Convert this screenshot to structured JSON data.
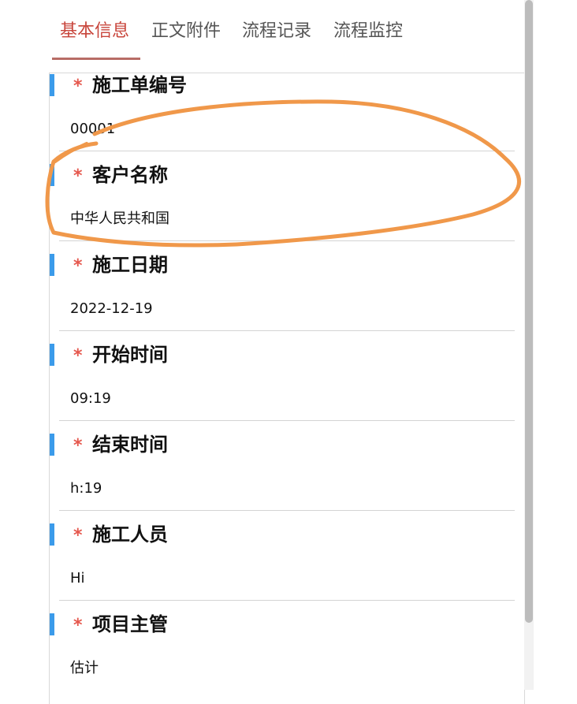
{
  "tabs": [
    {
      "label": "基本信息",
      "active": true
    },
    {
      "label": "正文附件",
      "active": false
    },
    {
      "label": "流程记录",
      "active": false
    },
    {
      "label": "流程监控",
      "active": false
    }
  ],
  "required_mark": "*",
  "fields": [
    {
      "label": "施工单编号",
      "value": "00001"
    },
    {
      "label": "客户名称",
      "value": "中华人民共和国"
    },
    {
      "label": "施工日期",
      "value": "2022-12-19"
    },
    {
      "label": "开始时间",
      "value": "09:19"
    },
    {
      "label": "结束时间",
      "value": "h:19"
    },
    {
      "label": "施工人员",
      "value": "Hi"
    },
    {
      "label": "项目主管",
      "value": "估计"
    }
  ],
  "colors": {
    "active_tab": "#c8453b",
    "accent_bar": "#3b9bea",
    "required_star": "#e5584e",
    "annotation_stroke": "#f0984a"
  }
}
